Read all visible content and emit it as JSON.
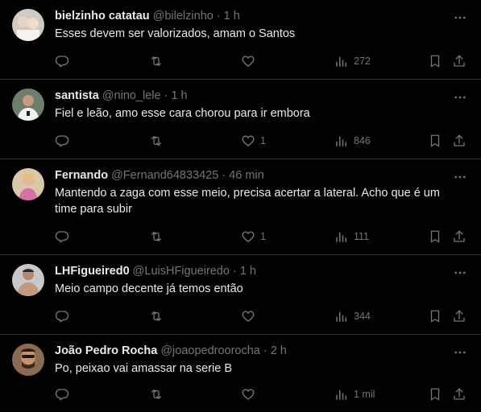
{
  "tweets": [
    {
      "name": "bielzinho catatau",
      "handle": "@bilelzinho",
      "time": "1 h",
      "text": "Esses devem ser valorizados, amam o Santos",
      "likes": "",
      "views": "272"
    },
    {
      "name": "santista",
      "handle": "@nino_lele",
      "time": "1 h",
      "text": "Fiel e leão, amo esse cara chorou para ir embora",
      "likes": "1",
      "views": "846"
    },
    {
      "name": "Fernando",
      "handle": "@Fernand64833425",
      "time": "46 min",
      "text": "Mantendo a zaga com esse meio, precisa acertar a lateral. Acho que é um time para subir",
      "likes": "1",
      "views": "111"
    },
    {
      "name": "LHFigueired0",
      "handle": "@LuisHFigueiredo",
      "time": "1 h",
      "text": "Meio campo decente já temos então",
      "likes": "",
      "views": "344"
    },
    {
      "name": "João Pedro Rocha",
      "handle": "@joaopedroorocha",
      "time": "2 h",
      "text": "Po, peixao vai amassar na serie B",
      "likes": "",
      "views": "1 mil"
    }
  ],
  "separator": "·",
  "icons": {
    "reply": "reply-icon",
    "retweet": "retweet-icon",
    "like": "heart-icon",
    "views": "views-icon",
    "bookmark": "bookmark-icon",
    "share": "share-icon",
    "more": "more-icon"
  },
  "colors": {
    "background": "#000000",
    "text": "#e7e9ea",
    "secondary": "#71767b",
    "divider": "#2f3336"
  }
}
